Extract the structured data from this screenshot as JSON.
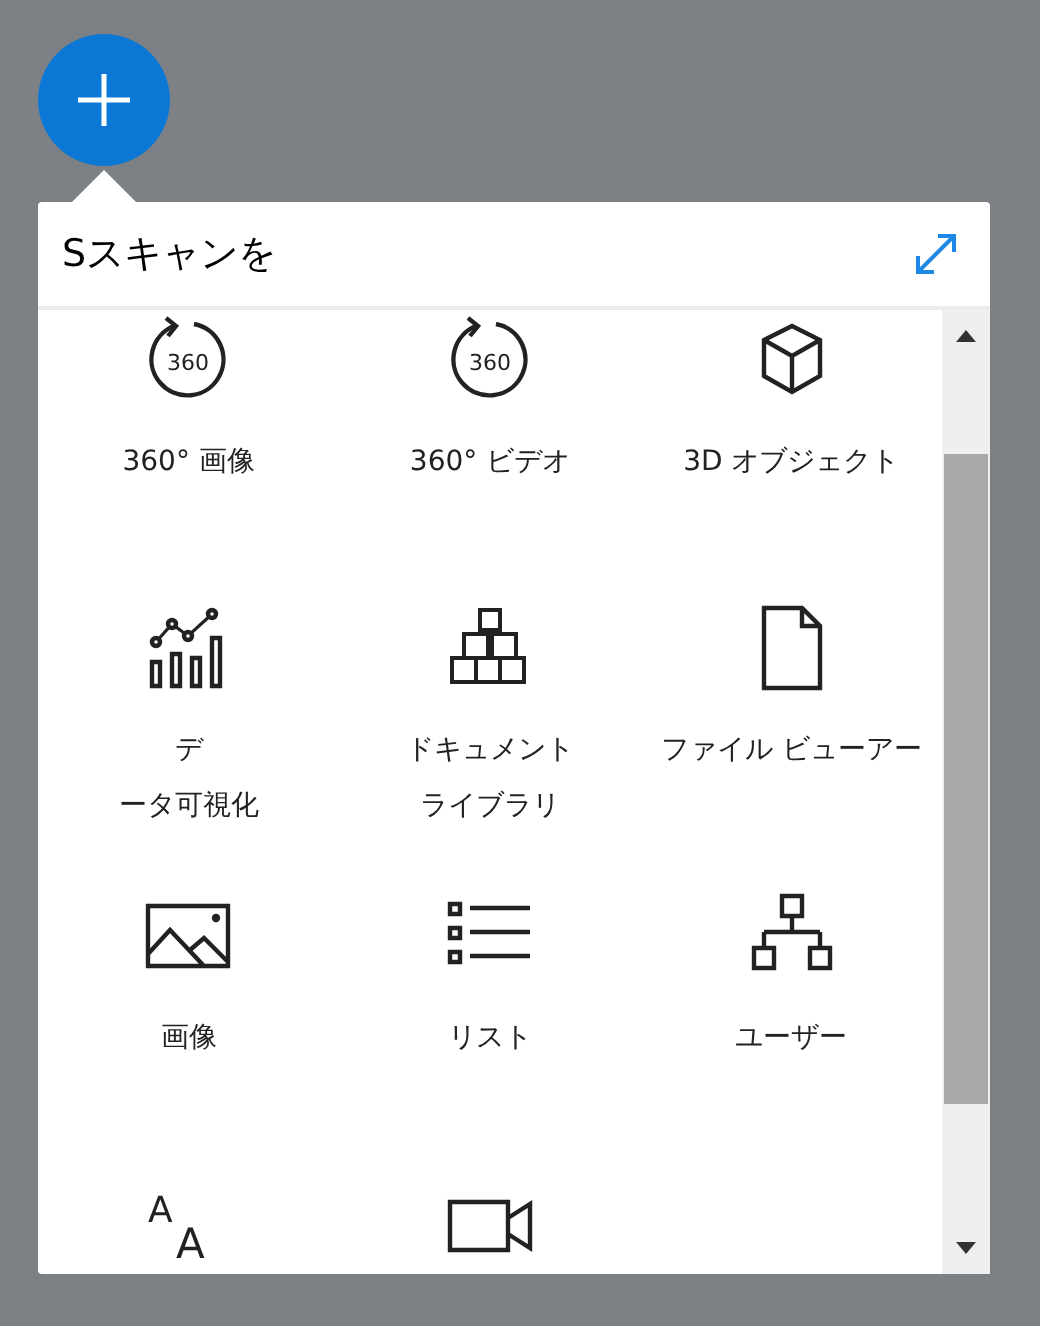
{
  "search": {
    "value": "Sスキャンを"
  },
  "items": [
    {
      "kind": "rotation",
      "icon_text": [
        "360"
      ],
      "label": [
        "360° 画像"
      ]
    },
    {
      "kind": "rotation",
      "icon_text": [
        "360"
      ],
      "label": [
        "360° ビデオ"
      ]
    },
    {
      "kind": "cube",
      "label": [
        "3D オブジェクト"
      ]
    },
    {
      "kind": "chart",
      "label": [
        "デ",
        "ータ可視化"
      ]
    },
    {
      "kind": "cubes",
      "label": [
        "ドキュメント",
        "ライブラリ"
      ]
    },
    {
      "kind": "file",
      "label": [
        "ファイル ビューアー"
      ]
    },
    {
      "kind": "picture",
      "label": [
        "画像"
      ]
    },
    {
      "kind": "list",
      "label": [
        "リスト"
      ]
    },
    {
      "kind": "org",
      "label": [
        "ユーザー"
      ]
    },
    {
      "kind": "text",
      "icon_text": [
        "A",
        "A"
      ]
    },
    {
      "kind": "video"
    }
  ]
}
